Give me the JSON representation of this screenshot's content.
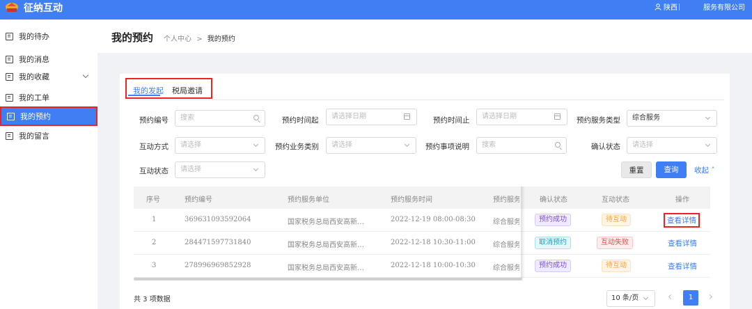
{
  "header": {
    "app_name": "征纳互动",
    "user_name": "陕西",
    "company_name": "服务有限公司",
    "brand_color": "#3f7ff3"
  },
  "sidebar": {
    "items": [
      {
        "label": "我的待办",
        "icon": "document-icon"
      },
      {
        "label": "我的消息",
        "icon": "document-icon"
      },
      {
        "label": "我的收藏",
        "icon": "document-icon"
      },
      {
        "label": "我的工单",
        "icon": "document-icon"
      },
      {
        "label": "我的预约",
        "icon": "document-icon",
        "active": true
      },
      {
        "label": "我的留言",
        "icon": "document-icon"
      }
    ]
  },
  "page": {
    "title": "我的预约",
    "breadcrumb": [
      "个人中心",
      "我的预约"
    ],
    "breadcrumb_sep": ">"
  },
  "tabs": [
    {
      "label": "我的发起",
      "active": true
    },
    {
      "label": "税局邀请"
    }
  ],
  "filters": {
    "appt_no": {
      "label": "预约编号",
      "placeholder": "搜索"
    },
    "time_from": {
      "label": "预约时间起",
      "placeholder": "请选择日期"
    },
    "time_to": {
      "label": "预约时间止",
      "placeholder": "请选择日期"
    },
    "service_type": {
      "label": "预约服务类型",
      "value": "综合服务"
    },
    "interact_mode": {
      "label": "互动方式",
      "placeholder": "请选择"
    },
    "business_type": {
      "label": "预约业务类别",
      "placeholder": "请选择"
    },
    "item_desc": {
      "label": "预约事项说明",
      "placeholder": "搜索"
    },
    "confirm_status": {
      "label": "确认状态",
      "placeholder": "请选择"
    },
    "interact_status": {
      "label": "互动状态",
      "placeholder": "请选择"
    },
    "reset_label": "重置",
    "query_label": "查询",
    "collapse_label": "收起"
  },
  "table": {
    "columns": [
      "序号",
      "预约编号",
      "预约服务单位",
      "预约服务时间",
      "预约服务",
      "确认状态",
      "互动状态",
      "操作"
    ],
    "rows": [
      {
        "index": "1",
        "appt_no": "369631093592064",
        "unit": "国家税务总局西安高新…",
        "time": "2022-12-19 08:00-08:30",
        "service": "综合服务",
        "confirm": "预约成功",
        "interact": "待互动",
        "action": "查看详情"
      },
      {
        "index": "2",
        "appt_no": "284471597731840",
        "unit": "国家税务总局西安高新…",
        "time": "2022-12-18 10:30-11:00",
        "service": "综合服务",
        "confirm": "取消预约",
        "interact": "互动失败",
        "action": "查看详情"
      },
      {
        "index": "3",
        "appt_no": "278996969852928",
        "unit": "国家税务总局西安高新…",
        "time": "2022-12-18 10:00-10:30",
        "service": "综合服务",
        "confirm": "预约成功",
        "interact": "待互动",
        "action": "查看详情"
      }
    ]
  },
  "pagination": {
    "total": "共 3 项数据",
    "page_size": "10 条/页",
    "current_page": "1"
  }
}
